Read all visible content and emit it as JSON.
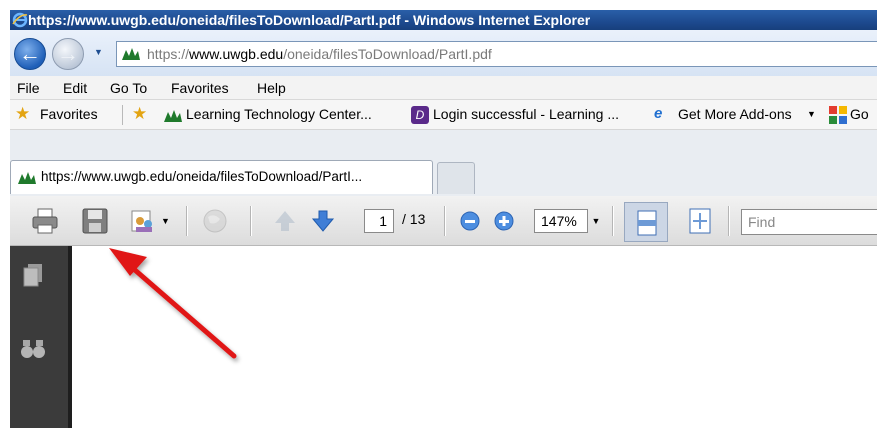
{
  "window": {
    "title": "https://www.uwgb.edu/oneida/filesToDownload/PartI.pdf - Windows Internet Explorer"
  },
  "address": {
    "scheme": "https://",
    "domain": "www.uwgb.edu",
    "path": "/oneida/filesToDownload/PartI.pdf"
  },
  "menu": [
    "File",
    "Edit",
    "Go To",
    "Favorites",
    "Help"
  ],
  "favorites": {
    "label": "Favorites",
    "items": [
      "Learning Technology Center...",
      "Login successful - Learning ...",
      "Get More Add-ons",
      "Go"
    ]
  },
  "tab": {
    "title": "https://www.uwgb.edu/oneida/filesToDownload/PartI..."
  },
  "pdf_toolbar": {
    "current_page": "1",
    "page_count": "/ 13",
    "zoom": "147%",
    "find_placeholder": "Find"
  },
  "colors": {
    "title_bar": "#1d4a8f",
    "annotation_arrow": "#e01818"
  }
}
